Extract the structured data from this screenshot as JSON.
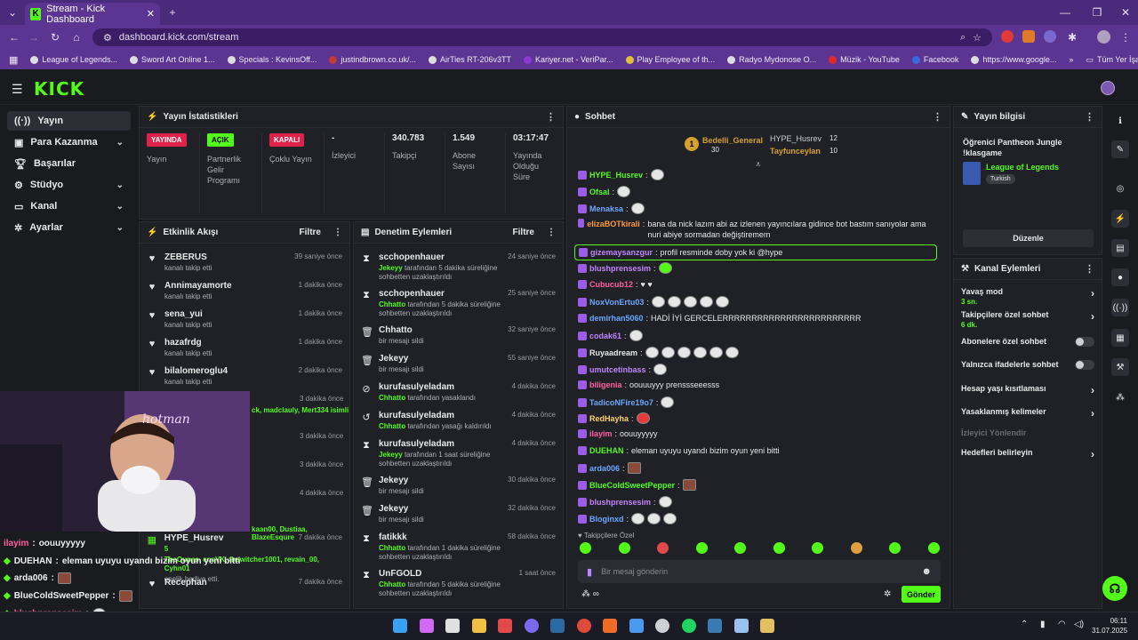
{
  "browser": {
    "tab_title": "Stream - Kick Dashboard",
    "url": "dashboard.kick.com/stream",
    "bookmarks": [
      "League of Legends...",
      "Sword Art Online 1...",
      "Specials : KevinsOff...",
      "justindbrown.co.uk/...",
      "AirTies RT-206v3TT",
      "Kariyer.net - VeriPar...",
      "Play Employee of th...",
      "Radyo Mydonose O...",
      "Müzik - YouTube",
      "Facebook",
      "https://www.google..."
    ],
    "all_bookmarks": "Tüm Yer İşaretleri"
  },
  "brand": {
    "logo": "KICK",
    "accent": "#53fc18"
  },
  "sidebar": {
    "items": [
      {
        "label": "Yayın",
        "icon": "broadcast-icon"
      },
      {
        "label": "Para Kazanma",
        "icon": "money-icon"
      },
      {
        "label": "Başarılar",
        "icon": "trophy-icon"
      },
      {
        "label": "Stüdyo",
        "icon": "studio-icon"
      },
      {
        "label": "Kanal",
        "icon": "channel-icon"
      },
      {
        "label": "Ayarlar",
        "icon": "gear-icon"
      }
    ]
  },
  "stats": {
    "title": "Yayın İstatistikleri",
    "cols": [
      {
        "badge": "YAYINDA",
        "label": "Yayın"
      },
      {
        "badge": "AÇIK",
        "label": "Partnerlik Gelir Programı"
      },
      {
        "badge": "KAPALI",
        "label": "Çoklu Yayın"
      },
      {
        "value": "-",
        "label": "İzleyici"
      },
      {
        "value": "340.783",
        "label": "Takipçi"
      },
      {
        "value": "1.549",
        "label": "Abone Sayısı"
      },
      {
        "value": "03:17:47",
        "label": "Yayında Olduğu Süre"
      }
    ]
  },
  "activity": {
    "title": "Etkinlik Akışı",
    "filter": "Filtre",
    "items": [
      {
        "name": "ZEBERUS",
        "sub": "kanalı takip etti",
        "time": "39 saniye önce"
      },
      {
        "name": "Annimayamorte",
        "sub": "kanalı takip etti",
        "time": "1 dakika önce"
      },
      {
        "name": "sena_yui",
        "sub": "kanalı takip etti",
        "time": "1 dakika önce"
      },
      {
        "name": "hazafrdg",
        "sub": "kanalı takip etti",
        "time": "1 dakika önce"
      },
      {
        "name": "bilalomeroglu4",
        "sub": "kanalı takip etti",
        "time": "2 dakika önce"
      }
    ],
    "partial_times": [
      "3 dakika önce",
      "3 dakika önce",
      "3 dakika önce",
      "4 dakika önce"
    ],
    "partial_text1": "ck, madclauly, Mert334 isimli",
    "partial_text2": "kaan00, Dustiaa, BlazeEsqure",
    "hype": {
      "name": "HYPE_Husrev",
      "time": "7 dakika önce",
      "count": "5",
      "gifted": "TheOupas, ensVK, thewitcher1001, revain_00, Cyhn01",
      "suffix": "onelik hediye etti."
    },
    "recep": {
      "name": "Recephan",
      "time": "7 dakika önce"
    }
  },
  "moderation": {
    "title": "Denetim Eylemleri",
    "filter": "Filtre",
    "items": [
      {
        "icon": "hourglass-icon",
        "name": "scchopenhauer",
        "actor": "Jekeyy",
        "sub": "tarafından 5 dakika süreliğine sohbetten uzaklaştırıldı",
        "time": "24 saniye önce"
      },
      {
        "icon": "hourglass-icon",
        "name": "scchopenhauer",
        "actor": "Chhatto",
        "sub": "tarafından 5 dakika süreliğine sohbetten uzaklaştırıldı",
        "time": "25 saniye önce"
      },
      {
        "icon": "trash-icon",
        "name": "Chhatto",
        "actor": "",
        "sub": "bir mesajı sildi",
        "time": "32 saniye önce"
      },
      {
        "icon": "trash-icon",
        "name": "Jekeyy",
        "actor": "",
        "sub": "bir mesajı sildi",
        "time": "55 saniye önce"
      },
      {
        "icon": "ban-icon",
        "name": "kurufasulyeladam",
        "actor": "Chhatto",
        "sub": "tarafından yasaklandı",
        "time": "4 dakika önce"
      },
      {
        "icon": "undo-icon",
        "name": "kurufasulyeladam",
        "actor": "Chhatto",
        "sub": "tarafından yasağı kaldırıldı",
        "time": "4 dakika önce"
      },
      {
        "icon": "hourglass-icon",
        "name": "kurufasulyeladam",
        "actor": "Jekeyy",
        "sub": "tarafından 1 saat süreliğine sohbetten uzaklaştırıldı",
        "time": "4 dakika önce"
      },
      {
        "icon": "trash-icon",
        "name": "Jekeyy",
        "actor": "",
        "sub": "bir mesajı sildi",
        "time": "30 dakika önce"
      },
      {
        "icon": "trash-icon",
        "name": "Jekeyy",
        "actor": "",
        "sub": "bir mesajı sildi",
        "time": "32 dakika önce"
      },
      {
        "icon": "hourglass-icon",
        "name": "fatikkk",
        "actor": "Chhatto",
        "sub": "tarafından 1 dakika süreliğine sohbetten uzaklaştırıldı",
        "time": "58 dakika önce"
      },
      {
        "icon": "hourglass-icon",
        "name": "UnFGOLD",
        "actor": "Chhatto",
        "sub": "tarafından 5 dakika süreliğine sohbetten uzaklaştırıldı",
        "time": "1 saat önce"
      }
    ]
  },
  "chat": {
    "title": "Sohbet",
    "leader": {
      "name": "Bedelli_General",
      "count": "30",
      "rank": "1"
    },
    "second": {
      "name": "HYPE_Husrev",
      "count": "12"
    },
    "third": {
      "name": "Tayfunceylan",
      "count": "10"
    },
    "messages": [
      {
        "user": "HYPE_Husrev",
        "color": "#53fc18",
        "text": "",
        "emotes": 1
      },
      {
        "user": "Ofsal",
        "color": "#53fc18",
        "text": "",
        "emotes": 1
      },
      {
        "user": "Menaksa",
        "color": "#6aa8ff",
        "text": "",
        "emotes": 1
      },
      {
        "user": "elizaBOTkirali",
        "color": "#ff9a3d",
        "text": "bana da nick lazım abi az izlenen yayıncılara gidince bot bastım sanıyolar ama nuri abiye sormadan değiştiremem",
        "emotes": 0
      },
      {
        "user": "gizemaysanzgur",
        "color": "#c084fc",
        "text": "profil resminde doby yok ki @hype",
        "emotes": 0
      },
      {
        "user": "blushprensesim",
        "color": "#c084fc",
        "text": "",
        "emotes": 1
      },
      {
        "user": "Cubucub12",
        "color": "#ff5fa2",
        "text": "♥ ♥",
        "emotes": 0
      },
      {
        "user": "NoxVonErtu03",
        "color": "#6aa8ff",
        "text": "",
        "emotes": 5
      },
      {
        "user": "demirhan5060",
        "color": "#6aa8ff",
        "text": "HADİ İYİ GERCELERRRRRRRRRRRRRRRRRRRRRRRR",
        "emotes": 0
      },
      {
        "user": "codak61",
        "color": "#c084fc",
        "text": "",
        "emotes": 1
      },
      {
        "user": "Ruyaadream",
        "color": "#e8e8ea",
        "text": "",
        "emotes": 6
      },
      {
        "user": "umutcetinbass",
        "color": "#c084fc",
        "text": "",
        "emotes": 1
      },
      {
        "user": "biligenia",
        "color": "#ff5fa2",
        "text": "oouuuyyy prenssseeesss",
        "emotes": 0
      },
      {
        "user": "TadicoNFire19o7",
        "color": "#6aa8ff",
        "text": "",
        "emotes": 1
      },
      {
        "user": "RedHayha",
        "color": "#ffd166",
        "text": "",
        "emotes": 1
      },
      {
        "user": "ilayim",
        "color": "#ff5fa2",
        "text": "oouuyyyyy",
        "emotes": 0
      },
      {
        "user": "DUEHAN",
        "color": "#53fc18",
        "text": "eleman uyuyu uyandı bizim oyun yeni bitti",
        "emotes": 0
      },
      {
        "user": "arda006",
        "color": "#6aa8ff",
        "text": "",
        "emotes": 1
      },
      {
        "user": "BlueColdSweetPepper",
        "color": "#53fc18",
        "text": "",
        "emotes": 1
      },
      {
        "user": "blushprensesim",
        "color": "#c084fc",
        "text": "",
        "emotes": 1
      },
      {
        "user": "Bloginxd",
        "color": "#6aa8ff",
        "text": "",
        "emotes": 3
      }
    ],
    "followers_only": "Takipçilere Özel",
    "placeholder": "Bir mesaj gönderin",
    "send": "Gönder"
  },
  "stream_info": {
    "title": "Yayın bilgisi",
    "stream_title": "Öğrenici Pantheon Jungle !klasgame",
    "category": "League of Legends",
    "tag": "Turkish",
    "edit": "Düzenle"
  },
  "channel_actions": {
    "title": "Kanal Eylemleri",
    "rows": [
      {
        "label": "Yavaş mod",
        "sub": "3 sn.",
        "type": "chevron"
      },
      {
        "label": "Takipçilere özel sohbet",
        "sub": "6 dk.",
        "type": "chevron"
      },
      {
        "label": "Abonelere özel sohbet",
        "sub": "",
        "type": "toggle"
      },
      {
        "label": "Yalnızca ifadelerle sohbet",
        "sub": "",
        "type": "toggle"
      },
      {
        "label": "Hesap yaşı kısıtlaması",
        "sub": "",
        "type": "chevron"
      },
      {
        "label": "Yasaklanmış kelimeler",
        "sub": "",
        "type": "chevron"
      },
      {
        "label": "İzleyici Yönlendir",
        "sub": "",
        "type": "disabled"
      },
      {
        "label": "Hedefleri belirleyin",
        "sub": "",
        "type": "chevron"
      }
    ]
  },
  "overlay_chat": [
    {
      "user": "ilayim",
      "color": "#ff5fa2",
      "text": "oouuyyyyy"
    },
    {
      "user": "DUEHAN",
      "color": "#e8e8ea",
      "text": "eleman uyuyu uyandı bizim oyun yeni bitti"
    },
    {
      "user": "arda006",
      "color": "#e8e8ea",
      "text": ""
    },
    {
      "user": "BlueColdSweetPepper",
      "color": "#e8e8ea",
      "text": ""
    },
    {
      "user": "blushprensesim",
      "color": "#ff5fa2",
      "text": ""
    }
  ],
  "taskbar": {
    "time": "06:11",
    "date": "31.07.2025"
  }
}
